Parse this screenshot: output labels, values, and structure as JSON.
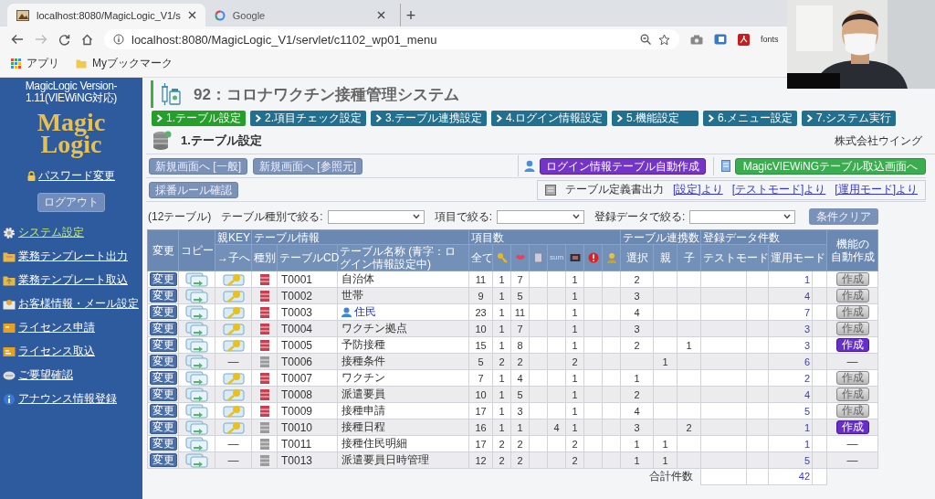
{
  "browser": {
    "tabs": [
      {
        "title": "localhost:8080/MagicLogic_V1/s",
        "selected": true
      },
      {
        "title": "Google",
        "selected": false
      }
    ],
    "new_tab": "+",
    "address": "localhost:8080/MagicLogic_V1/servlet/c1102_wp01_menu",
    "extension_label": "fonts",
    "bookmarks": [
      "アプリ",
      "Myブックマーク"
    ]
  },
  "sidebar": {
    "version": "MagicLogic Version-1.11(VIEWiNG対応)",
    "logo": [
      "Magic",
      "Logic"
    ],
    "password_link": "パスワード変更",
    "logout": "ログアウト",
    "items": [
      {
        "label": "システム設定",
        "selected": true
      },
      {
        "label": "業務テンプレート出力",
        "selected": false
      },
      {
        "label": "業務テンプレート取込",
        "selected": false
      },
      {
        "label": "お客様情報・メール設定",
        "selected": false
      },
      {
        "label": "ライセンス申請",
        "selected": false
      },
      {
        "label": "ライセンス取込",
        "selected": false
      },
      {
        "label": "ご要望確認",
        "selected": false
      },
      {
        "label": "アナウンス情報登録",
        "selected": false
      }
    ]
  },
  "header": {
    "title": "92：コロナワクチン接種管理システム",
    "steps": [
      {
        "label": "1.テーブル設定",
        "selected": true
      },
      {
        "label": "2.項目チェック設定",
        "selected": false
      },
      {
        "label": "3.テーブル連携設定",
        "selected": false
      },
      {
        "label": "4.ログイン情報設定",
        "selected": false
      },
      {
        "label": "5.機能設定",
        "selected": false
      },
      {
        "label": "6.メニュー設定",
        "selected": false
      },
      {
        "label": "7.システム実行",
        "selected": false
      }
    ],
    "section_title": "1.テーブル設定",
    "company": "株式会社ウイング"
  },
  "toolbar": {
    "buttons": [
      "新規画面へ [一般]",
      "新規画面へ [参照元]",
      "採番ルール確認"
    ],
    "login_auto": "ログイン情報テーブル自動作成",
    "viewing_import": "MagicVIEWiNGテーブル取込画面へ",
    "definition_label": "テーブル定義書出力",
    "definition_links": [
      "[設定]より",
      "[テストモード]より",
      "[運用モード]より"
    ]
  },
  "filters": {
    "count": "(12テーブル)",
    "fields": [
      {
        "label": "テーブル種別で絞る:"
      },
      {
        "label": "項目で絞る:"
      },
      {
        "label": "登録データで絞る:"
      }
    ],
    "clear": "条件クリア"
  },
  "table": {
    "header": {
      "change": "変更",
      "copy": "コピー",
      "parent_key": "親KEY",
      "to_child": "→子へ",
      "table_info": "テーブル情報",
      "type": "種別",
      "code": "テーブルCD",
      "name": "テーブル名称 (青字：ログイン情報設定中)",
      "items": "項目数",
      "all": "全て",
      "sum": "sum",
      "links": "テーブル連携数",
      "select": "選択",
      "parent": "親",
      "child": "子",
      "records": "登録データ件数",
      "test_mode": "テストモード",
      "production_mode": "運用モード",
      "auto_create": [
        "機能の",
        "自動作成"
      ]
    },
    "rows": [
      {
        "change": "変更",
        "parent_key": {
          "kind": "icon"
        },
        "color": "#c8404f",
        "code": "T0001",
        "name": "自治体",
        "login": false,
        "items": {
          "all": "11",
          "key": "1",
          "col_3": "7",
          "col_6": "1"
        },
        "links": {
          "select": "2"
        },
        "production": "1",
        "create": {
          "kind": "button",
          "label": "作成",
          "active": false
        }
      },
      {
        "change": "変更",
        "parent_key": {
          "kind": "icon"
        },
        "color": "#c8404f",
        "code": "T0002",
        "name": "世帯",
        "login": false,
        "items": {
          "all": "9",
          "key": "1",
          "col_3": "5",
          "col_6": "1"
        },
        "links": {
          "select": "3"
        },
        "production": "4",
        "create": {
          "kind": "button",
          "label": "作成",
          "active": false
        }
      },
      {
        "change": "変更",
        "parent_key": {
          "kind": "icon"
        },
        "color": "#c8404f",
        "code": "T0003",
        "name": "住民",
        "login": true,
        "items": {
          "all": "23",
          "key": "1",
          "col_3": "11",
          "col_6": "1"
        },
        "links": {
          "select": "4"
        },
        "production": "7",
        "create": {
          "kind": "button",
          "label": "作成",
          "active": false
        }
      },
      {
        "change": "変更",
        "parent_key": {
          "kind": "icon"
        },
        "color": "#c8404f",
        "code": "T0004",
        "name": "ワクチン拠点",
        "login": false,
        "items": {
          "all": "10",
          "key": "1",
          "col_3": "7",
          "col_6": "1"
        },
        "links": {
          "select": "3"
        },
        "production": "3",
        "create": {
          "kind": "button",
          "label": "作成",
          "active": false
        }
      },
      {
        "change": "変更",
        "parent_key": {
          "kind": "icon"
        },
        "color": "#c8404f",
        "code": "T0005",
        "name": "予防接種",
        "login": false,
        "items": {
          "all": "15",
          "key": "1",
          "col_3": "8",
          "col_6": "1"
        },
        "links": {
          "select": "2",
          "child": "1"
        },
        "production": "3",
        "create": {
          "kind": "button",
          "label": "作成",
          "active": true
        }
      },
      {
        "change": "変更",
        "parent_key": {
          "kind": "none",
          "label": "—"
        },
        "color": "#9a9a9a",
        "code": "T0006",
        "name": "接種条件",
        "login": false,
        "items": {
          "all": "5",
          "key": "2",
          "col_3": "2",
          "col_6": "2"
        },
        "links": {
          "parent": "1"
        },
        "production": "6",
        "create": {
          "kind": "none",
          "label": "—"
        }
      },
      {
        "change": "変更",
        "parent_key": {
          "kind": "icon"
        },
        "color": "#c8404f",
        "code": "T0007",
        "name": "ワクチン",
        "login": false,
        "items": {
          "all": "7",
          "key": "1",
          "col_3": "4",
          "col_6": "1"
        },
        "links": {
          "select": "1"
        },
        "production": "2",
        "create": {
          "kind": "button",
          "label": "作成",
          "active": false
        }
      },
      {
        "change": "変更",
        "parent_key": {
          "kind": "icon"
        },
        "color": "#c8404f",
        "code": "T0008",
        "name": "派遣要員",
        "login": false,
        "items": {
          "all": "10",
          "key": "1",
          "col_3": "5",
          "col_6": "1"
        },
        "links": {
          "select": "2"
        },
        "production": "4",
        "create": {
          "kind": "button",
          "label": "作成",
          "active": false
        }
      },
      {
        "change": "変更",
        "parent_key": {
          "kind": "icon"
        },
        "color": "#c8404f",
        "code": "T0009",
        "name": "接種申請",
        "login": false,
        "items": {
          "all": "17",
          "key": "1",
          "col_3": "3",
          "col_6": "1"
        },
        "links": {
          "select": "4"
        },
        "production": "5",
        "create": {
          "kind": "button",
          "label": "作成",
          "active": false
        }
      },
      {
        "change": "変更",
        "parent_key": {
          "kind": "icon"
        },
        "color": "#9a9a9a",
        "code": "T0010",
        "name": "接種日程",
        "login": false,
        "items": {
          "all": "16",
          "key": "1",
          "col_3": "1",
          "sum": "4",
          "col_6": "1"
        },
        "links": {
          "select": "3",
          "child": "2"
        },
        "production": "1",
        "create": {
          "kind": "button",
          "label": "作成",
          "active": true
        }
      },
      {
        "change": "変更",
        "parent_key": {
          "kind": "none",
          "label": "—"
        },
        "color": "#9a9a9a",
        "code": "T0011",
        "name": "接種住民明細",
        "login": false,
        "items": {
          "all": "17",
          "key": "2",
          "col_3": "2",
          "col_6": "2"
        },
        "links": {
          "select": "1",
          "parent": "1"
        },
        "production": "1",
        "create": {
          "kind": "none",
          "label": "—"
        }
      },
      {
        "change": "変更",
        "parent_key": {
          "kind": "none",
          "label": "—"
        },
        "color": "#9a9a9a",
        "code": "T0013",
        "name": "派遣要員日時管理",
        "login": false,
        "items": {
          "all": "12",
          "key": "2",
          "col_3": "2",
          "col_6": "2"
        },
        "links": {
          "select": "1",
          "parent": "1"
        },
        "production": "5",
        "create": {
          "kind": "none",
          "label": "—"
        }
      }
    ],
    "total_label": "合計件数",
    "total": "42"
  }
}
